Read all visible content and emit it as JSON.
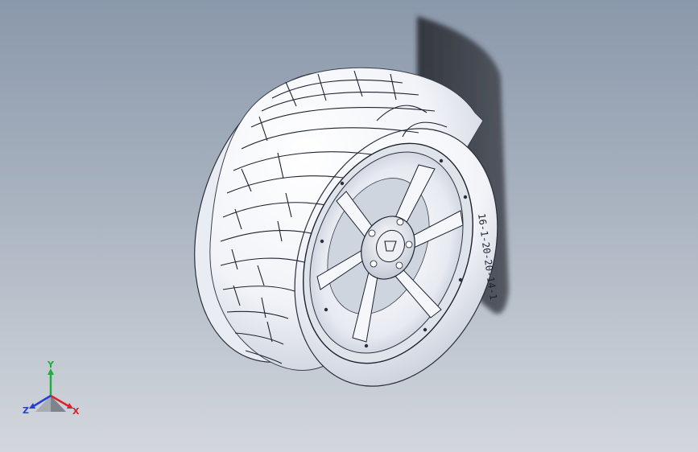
{
  "viewport": {
    "model": "wheel-assembly",
    "sidewall_marking": "16-1-20-20-14-1"
  },
  "triad": {
    "x_label": "X",
    "y_label": "Y",
    "z_label": "Z",
    "colors": {
      "x": "#e0202a",
      "y": "#1fae3a",
      "z": "#2540d8"
    }
  }
}
